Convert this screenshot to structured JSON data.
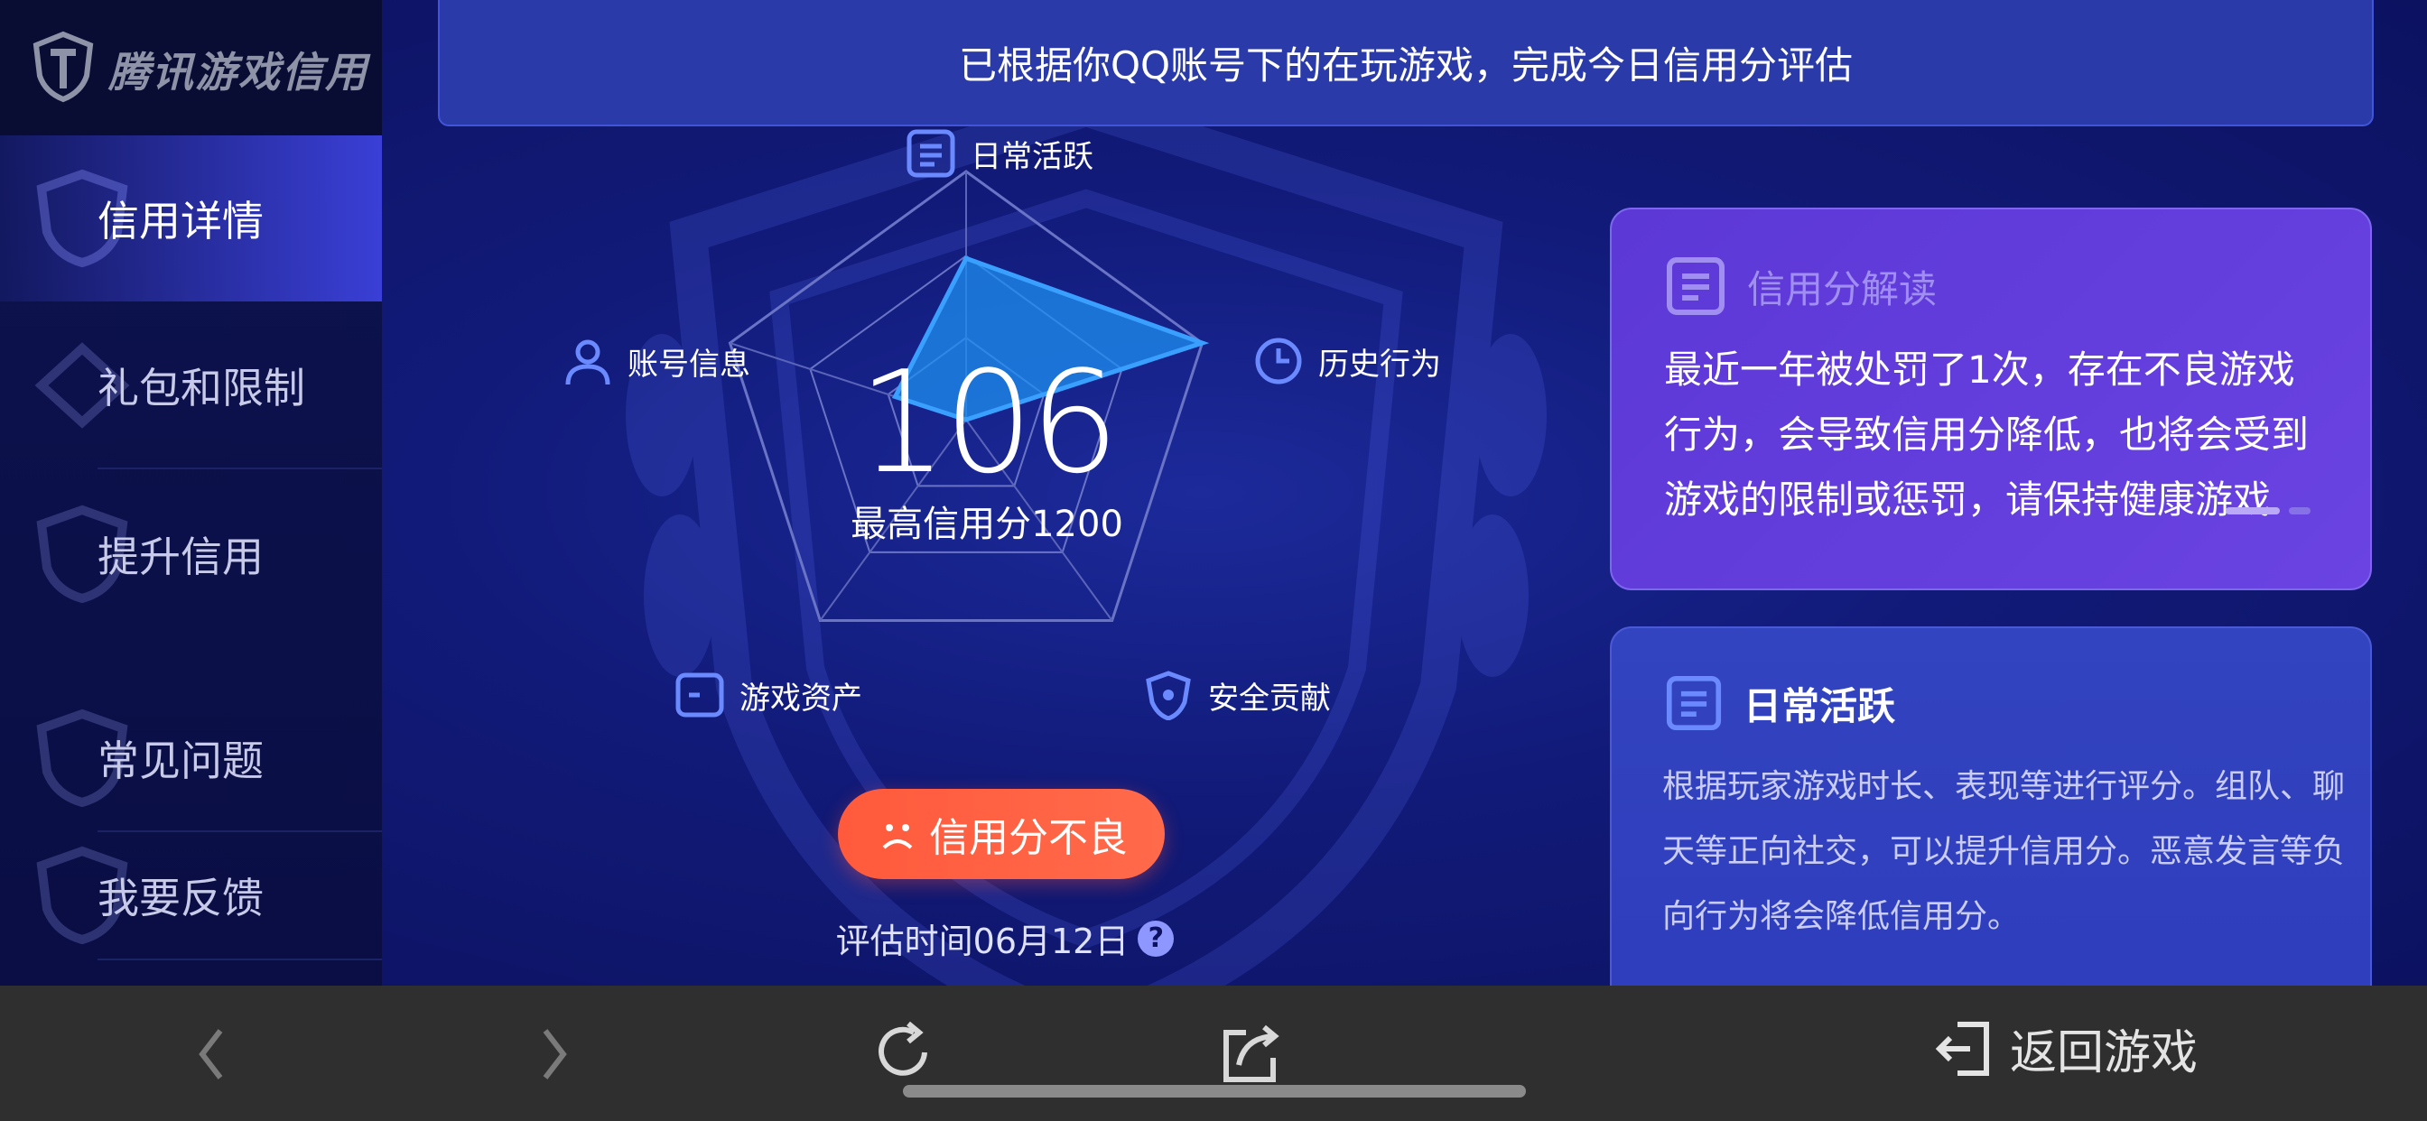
{
  "brand": {
    "name": "腾讯游戏信用"
  },
  "sidebar": {
    "items": [
      {
        "label": "信用详情",
        "active": true
      },
      {
        "label": "礼包和限制"
      },
      {
        "label": "提升信用"
      },
      {
        "label": "常见问题"
      },
      {
        "label": "我要反馈"
      }
    ]
  },
  "banner": {
    "text": "已根据你QQ账号下的在玩游戏，完成今日信用分评估"
  },
  "radar": {
    "axes": [
      "日常活跃",
      "历史行为",
      "安全贡献",
      "游戏资产",
      "账号信息"
    ],
    "values": [
      0.65,
      1.0,
      0.0,
      0.0,
      0.3
    ],
    "score": "106",
    "score_sub": "最高信用分1200",
    "status_label": "信用分不良",
    "eval_time": "评估时间06月12日"
  },
  "interpretation": {
    "title": "信用分解读",
    "body": "最近一年被处罚了1次，存在不良游戏行为，会导致信用分降低，也将会受到游戏的限制或惩罚，请保持健康游戏"
  },
  "detail": {
    "title": "日常活跃",
    "body": "根据玩家游戏时长、表现等进行评分。组队、聊天等正向社交，可以提升信用分。恶意发言等负向行为将会降低信用分。"
  },
  "bottombar": {
    "return_label": "返回游戏"
  },
  "colors": {
    "accent": "#3a3fd6",
    "status": "#ff5a3c",
    "radar_fill": "#1e8ff0"
  }
}
